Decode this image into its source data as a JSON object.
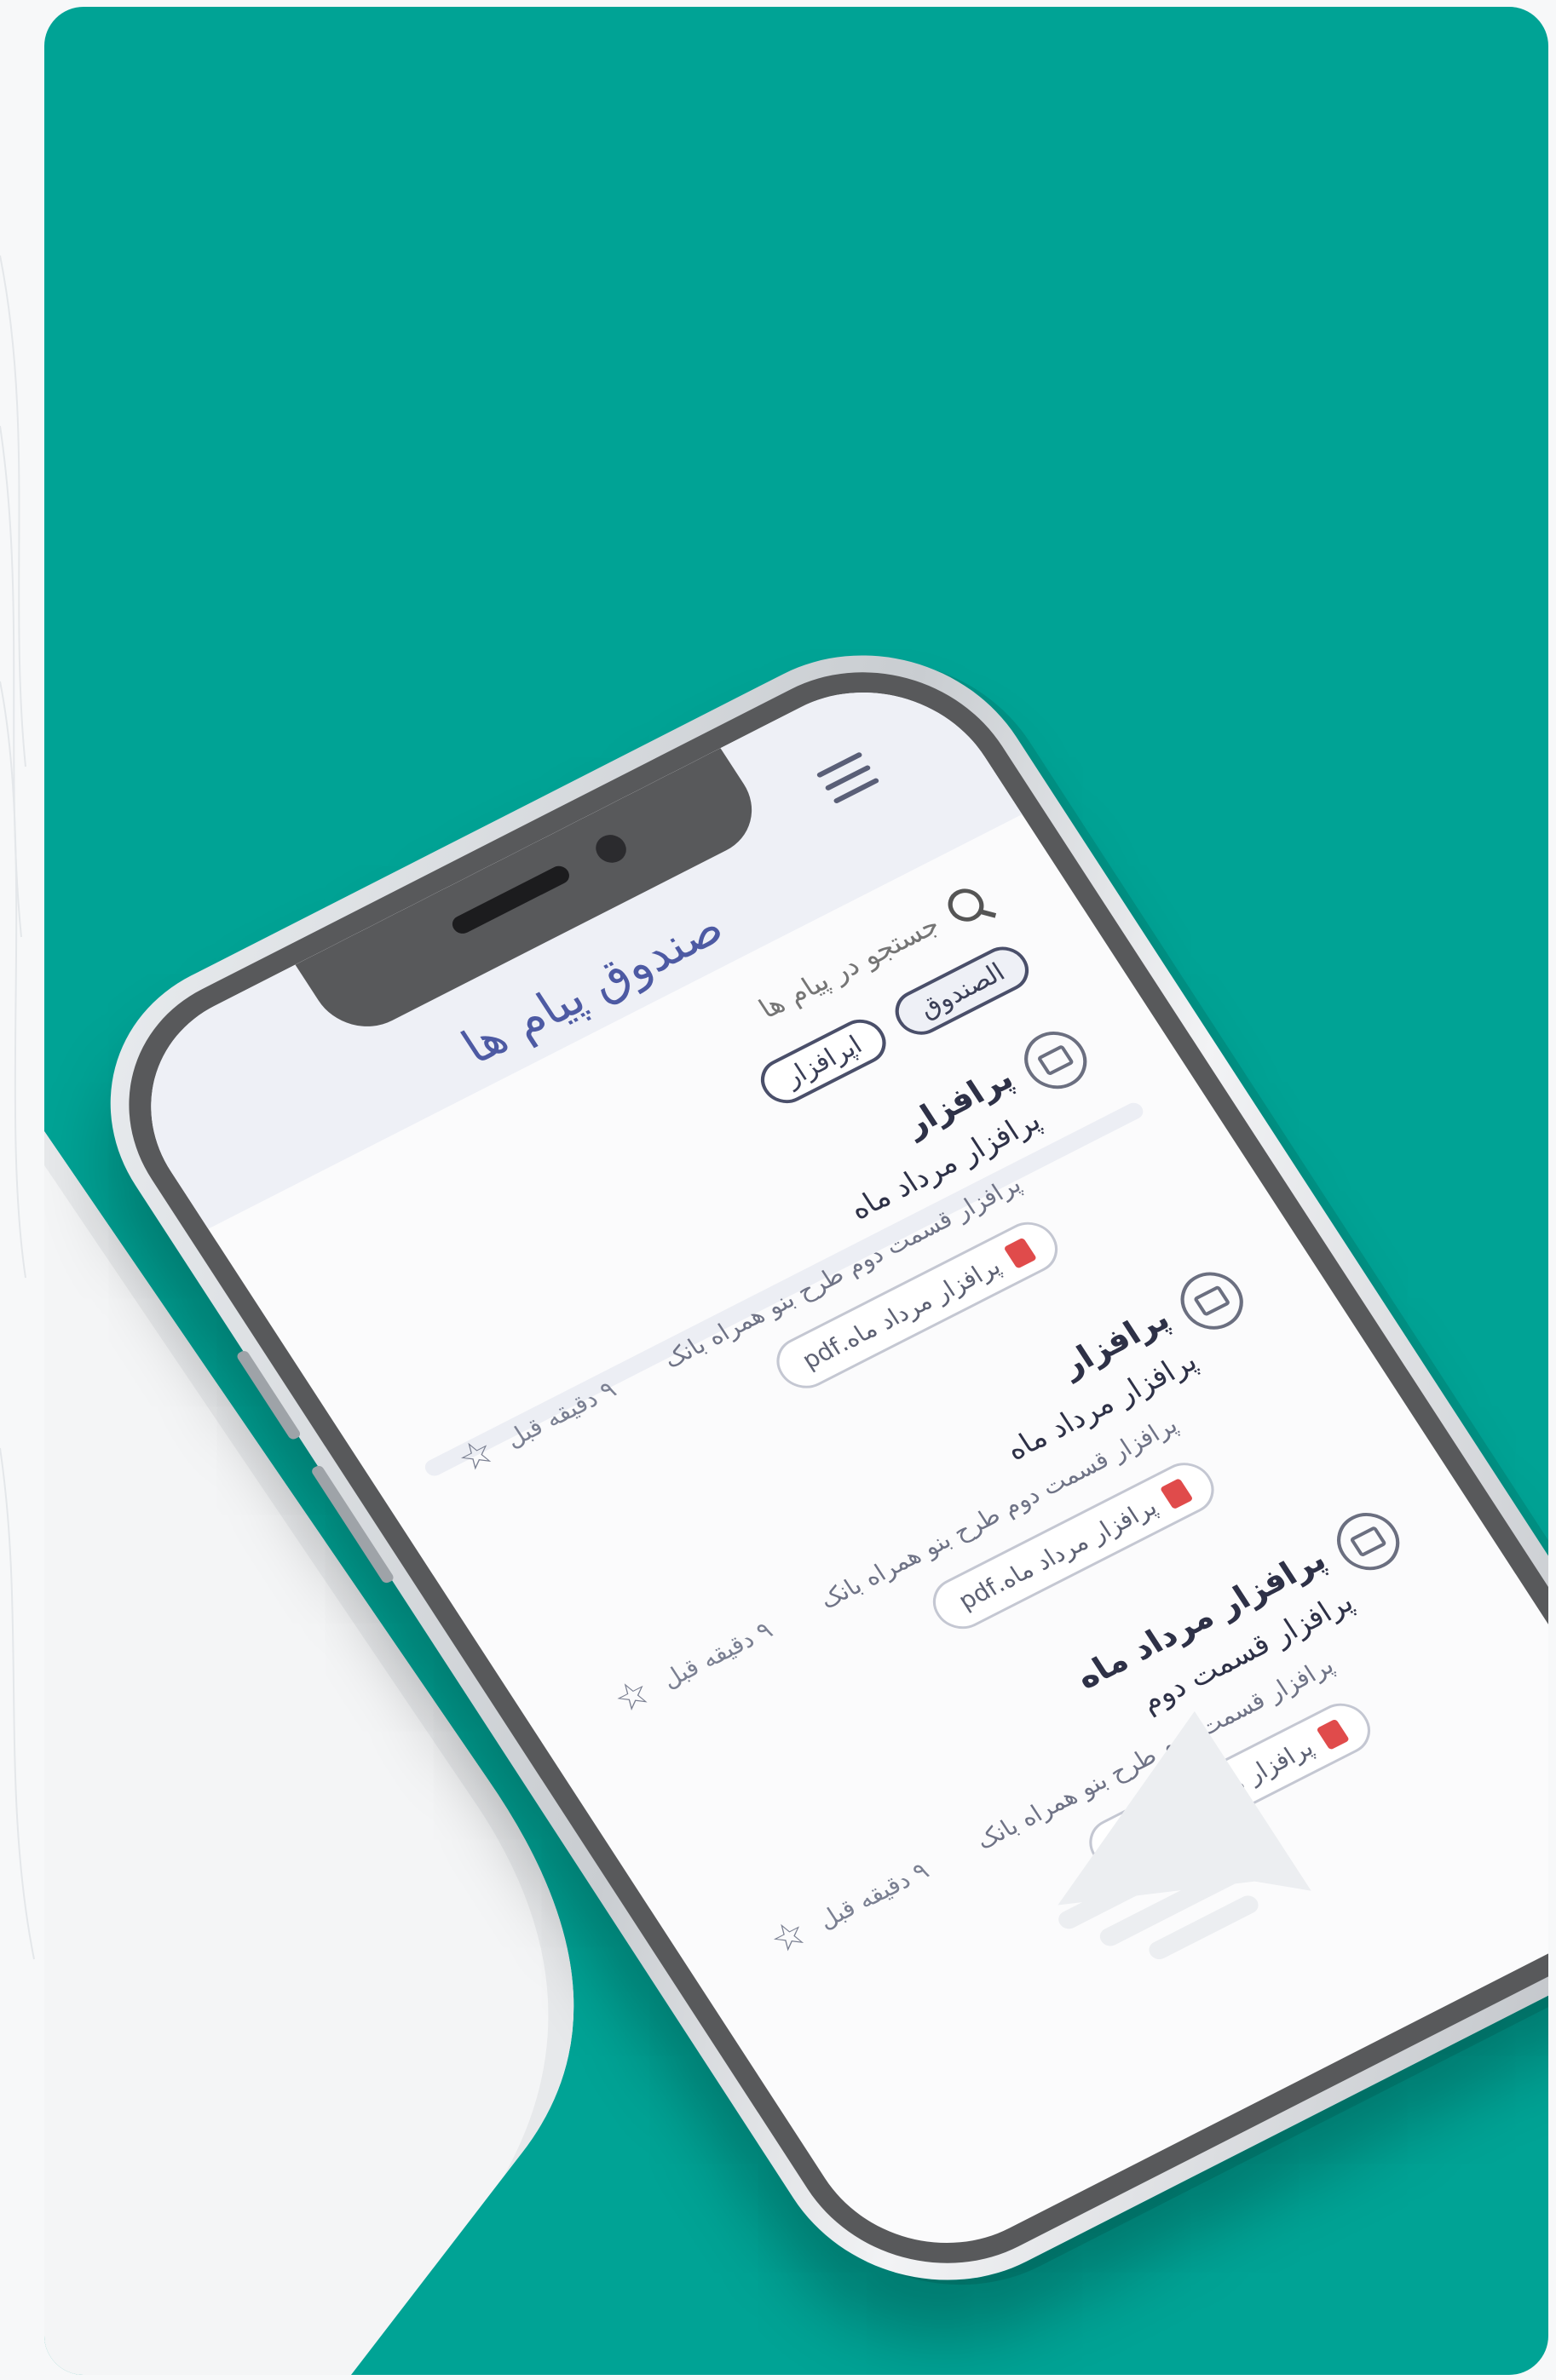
{
  "screen": {
    "title": "صندوق پیام ها",
    "search": {
      "placeholder": "جستجو در پیام ها"
    },
    "filters": [
      {
        "label": "الصندوق",
        "active": true
      },
      {
        "label": "اپرافزار",
        "active": false
      }
    ],
    "messages": [
      {
        "sender": "پرافزار",
        "subject": "پرافزار مرداد ماه",
        "preview": "پرافزار قسمت دوم طرح بنو همراه بانک",
        "attachment": "پرافزار مرداد ماه.pdf",
        "time": "۹ دقیقه قبل"
      },
      {
        "sender": "پرافزار",
        "subject": "پرافزار مرداد ماه",
        "preview": "پرافزار قسمت دوم طرح بنو همراه بانک",
        "attachment": "پرافزار مرداد ماه.pdf",
        "time": "۹ دقیقه قبل"
      },
      {
        "sender": "پرافزار مرداد ماه",
        "subject": "پرافزار قسمت دوم",
        "preview": "پرافزار قسمت دوم طرح بنو همراه بانک",
        "attachment": "پرافزار مرداد ماه.pdf",
        "time": "۹ دقیقه قبل"
      }
    ]
  },
  "colors": {
    "background_teal": "#00a395",
    "screen_bg": "#fbfbfc",
    "title_color": "#4d5aa3",
    "bezel": "#58595b"
  },
  "icons": [
    "menu-icon",
    "search-icon",
    "mail-icon",
    "pdf-icon",
    "star-icon",
    "paper-plane-icon"
  ]
}
